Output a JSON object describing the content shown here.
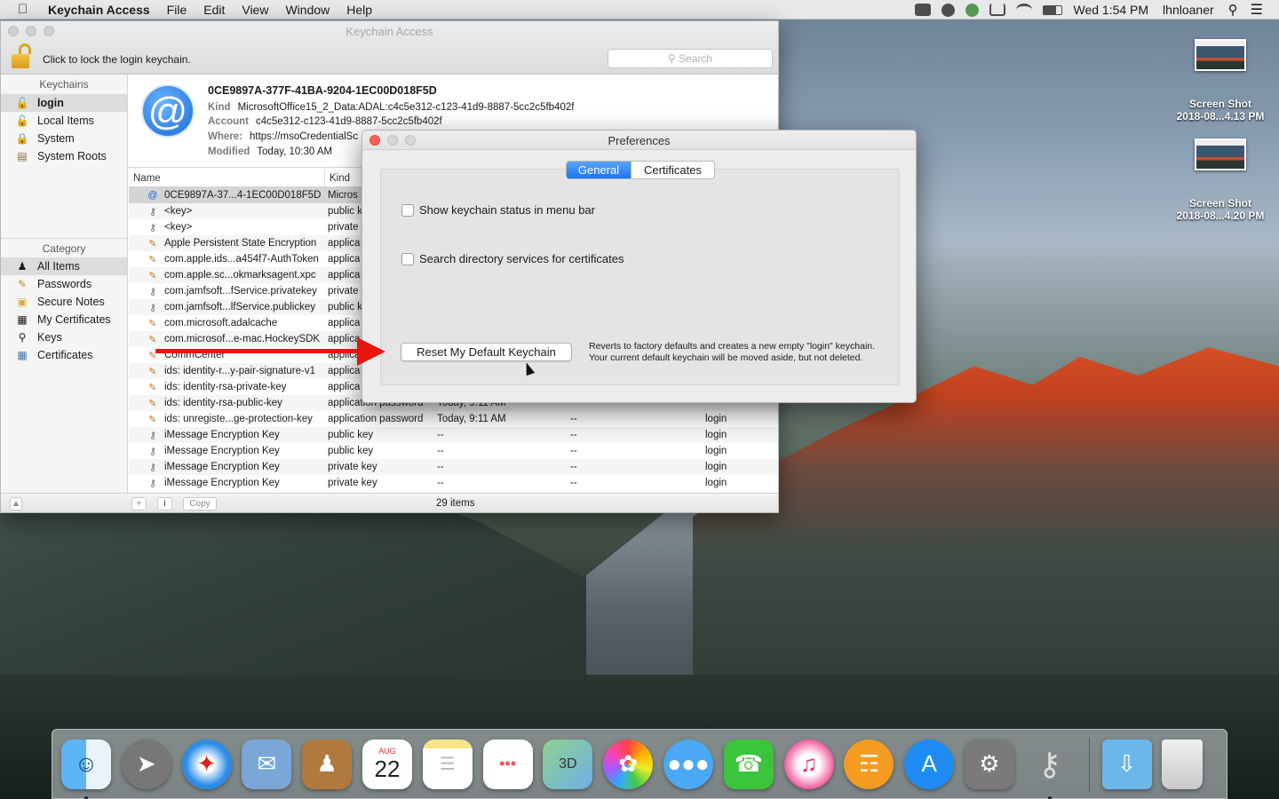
{
  "menubar": {
    "app_name": "Keychain Access",
    "menus": [
      "File",
      "Edit",
      "View",
      "Window",
      "Help"
    ],
    "clock": "Wed 1:54 PM",
    "user": "lhnloaner",
    "icons": [
      "creative-cloud-icon",
      "globe-icon",
      "sync-icon",
      "airplay-icon",
      "wifi-icon",
      "battery-icon",
      "search-icon",
      "notification-list-icon"
    ]
  },
  "desktop": {
    "files": [
      {
        "name_line1": "Screen Shot",
        "name_line2": "2018-08...4.13 PM"
      },
      {
        "name_line1": "Screen Shot",
        "name_line2": "2018-08...4.20 PM"
      }
    ]
  },
  "keychain": {
    "title": "Keychain Access",
    "lock_text": "Click to lock the login keychain.",
    "search_placeholder": "Search",
    "keychains_header": "Keychains",
    "keychains": [
      "login",
      "Local Items",
      "System",
      "System Roots"
    ],
    "category_header": "Category",
    "categories": [
      "All Items",
      "Passwords",
      "Secure Notes",
      "My Certificates",
      "Keys",
      "Certificates"
    ],
    "detail": {
      "title": "0CE9897A-377F-41BA-9204-1EC00D018F5D",
      "kind_label": "Kind",
      "kind_value": "MicrosoftOffice15_2_Data:ADAL:c4c5e312-c123-41d9-8887-5cc2c5fb402f",
      "account_label": "Account",
      "account_value": "c4c5e312-c123-41d9-8887-5cc2c5fb402f",
      "where_label": "Where:",
      "where_value": "https://msoCredentialSc",
      "modified_label": "Modified",
      "modified_value": "Today, 10:30 AM"
    },
    "columns": [
      "Name",
      "Kind"
    ],
    "rows": [
      {
        "name": "0CE9897A-37...4-1EC00D018F5D",
        "kind": "Micros",
        "date": "",
        "expires": "",
        "keychain": ""
      },
      {
        "name": "<key>",
        "kind": "public k",
        "date": "",
        "expires": "",
        "keychain": ""
      },
      {
        "name": "<key>",
        "kind": "private",
        "date": "",
        "expires": "",
        "keychain": ""
      },
      {
        "name": "Apple Persistent State Encryption",
        "kind": "applica",
        "date": "",
        "expires": "",
        "keychain": ""
      },
      {
        "name": "com.apple.ids...a454f7-AuthToken",
        "kind": "applica",
        "date": "",
        "expires": "",
        "keychain": ""
      },
      {
        "name": "com.apple.sc...okmarksagent.xpc",
        "kind": "applica",
        "date": "",
        "expires": "",
        "keychain": ""
      },
      {
        "name": "com.jamfsoft...fService.privatekey",
        "kind": "private",
        "date": "",
        "expires": "",
        "keychain": ""
      },
      {
        "name": "com.jamfsoft...lfService.publickey",
        "kind": "public k",
        "date": "",
        "expires": "",
        "keychain": ""
      },
      {
        "name": "com.microsoft.adalcache",
        "kind": "applica",
        "date": "",
        "expires": "",
        "keychain": ""
      },
      {
        "name": "com.microsof...e-mac.HockeySDK",
        "kind": "applica",
        "date": "",
        "expires": "",
        "keychain": ""
      },
      {
        "name": "CommCenter",
        "kind": "applica",
        "date": "",
        "expires": "",
        "keychain": ""
      },
      {
        "name": "ids: identity-r...y-pair-signature-v1",
        "kind": "applica",
        "date": "",
        "expires": "",
        "keychain": ""
      },
      {
        "name": "ids: identity-rsa-private-key",
        "kind": "applica",
        "date": "",
        "expires": "",
        "keychain": ""
      },
      {
        "name": "ids: identity-rsa-public-key",
        "kind": "application password",
        "date": "Today, 9:11 AM",
        "expires": "",
        "keychain": ""
      },
      {
        "name": "ids: unregiste...ge-protection-key",
        "kind": "application password",
        "date": "Today, 9:11 AM",
        "expires": "--",
        "keychain": "login"
      },
      {
        "name": "iMessage Encryption Key",
        "kind": "public key",
        "date": "--",
        "expires": "--",
        "keychain": "login"
      },
      {
        "name": "iMessage Encryption Key",
        "kind": "public key",
        "date": "--",
        "expires": "--",
        "keychain": "login"
      },
      {
        "name": "iMessage Encryption Key",
        "kind": "private key",
        "date": "--",
        "expires": "--",
        "keychain": "login"
      },
      {
        "name": "iMessage Encryption Key",
        "kind": "private key",
        "date": "--",
        "expires": "--",
        "keychain": "login"
      }
    ],
    "copy_label": "Copy",
    "items_count": "29 items"
  },
  "prefs": {
    "title": "Preferences",
    "tabs": [
      "General",
      "Certificates"
    ],
    "show_status_label": "Show keychain status in menu bar",
    "search_dir_label": "Search directory services for certificates",
    "reset_label": "Reset My Default Keychain",
    "reset_note_line1": "Reverts to factory defaults and creates a new empty \"login\" keychain.",
    "reset_note_line2": "Your current default keychain will be moved aside, but not deleted."
  },
  "dock": {
    "month": "AUG",
    "day": "22",
    "apps": [
      "finder",
      "launchpad",
      "safari",
      "mail",
      "contacts",
      "calendar",
      "notes",
      "reminders",
      "maps",
      "photos",
      "messages",
      "facetime",
      "itunes",
      "ibooks",
      "app-store",
      "system-preferences",
      "keychain-access",
      "downloads",
      "trash"
    ]
  },
  "colors": {
    "accent": "#1b74f0",
    "annotation_arrow": "#e8150f",
    "close_button": "#fc5f57"
  }
}
